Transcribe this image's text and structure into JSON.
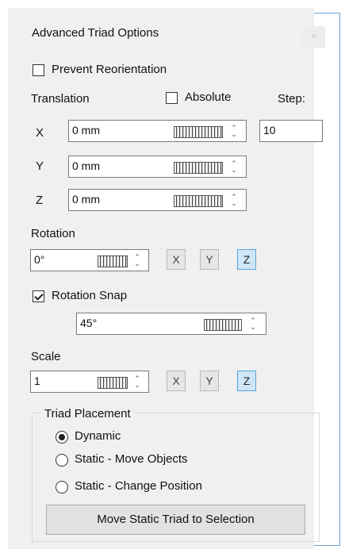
{
  "dialog": {
    "title": "Advanced Triad Options",
    "close_label": "×"
  },
  "prevent_reorientation": {
    "label": "Prevent Reorientation",
    "checked": false
  },
  "translation": {
    "label": "Translation",
    "absolute_label": "Absolute",
    "absolute_checked": false,
    "step_label": "Step:",
    "step_value": "10",
    "axes": [
      {
        "axis": "X",
        "value": "0 mm"
      },
      {
        "axis": "Y",
        "value": "0 mm"
      },
      {
        "axis": "Z",
        "value": "0 mm"
      }
    ]
  },
  "rotation": {
    "label": "Rotation",
    "value": "0°",
    "axis_buttons": [
      "X",
      "Y",
      "Z"
    ],
    "active_axis": "Z"
  },
  "rotation_snap": {
    "label": "Rotation Snap",
    "checked": true,
    "value": "45°"
  },
  "scale": {
    "label": "Scale",
    "value": "1",
    "axis_buttons": [
      "X",
      "Y",
      "Z"
    ],
    "active_axis": "Z"
  },
  "triad_placement": {
    "label": "Triad Placement",
    "options": [
      "Dynamic",
      "Static - Move Objects",
      "Static - Change Position"
    ],
    "selected": "Dynamic",
    "button_label": "Move Static Triad to Selection"
  },
  "spinner": {
    "up": "⌃",
    "down": "⌄"
  },
  "colors": {
    "active_button": "#cfe6f8",
    "frame_border": "#6aa2d8"
  }
}
